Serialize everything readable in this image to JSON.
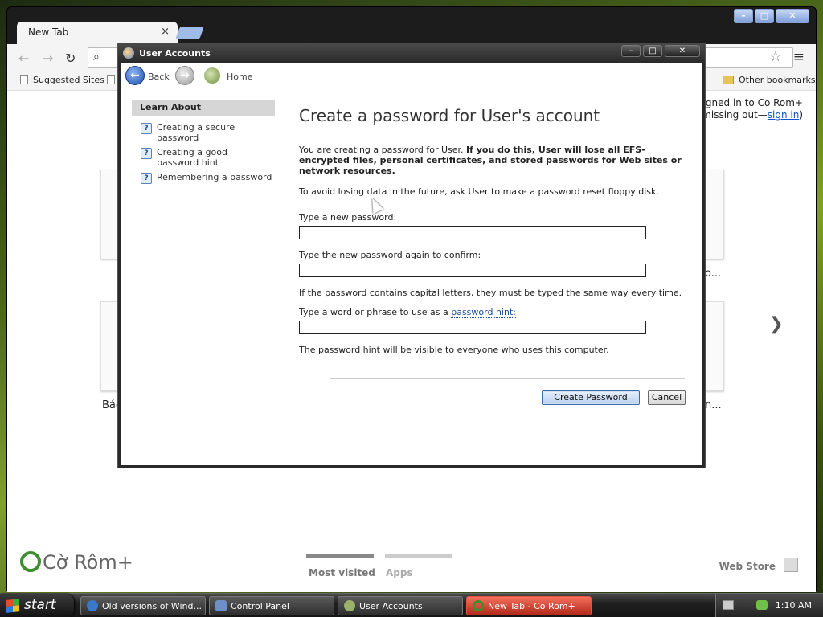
{
  "browser": {
    "tab_title": "New Tab",
    "tab_close": "×",
    "bookmarks": {
      "suggested": "Suggested Sites",
      "other": "Other bookmarks"
    },
    "ntp": {
      "signin_line1": "signed in to Co Rom+",
      "signin_line2_prefix": "e missing out—",
      "signin_link": "sign in",
      "signin_suffix": ")",
      "caption_left": "Bác",
      "caption_right_top": "o...",
      "caption_right_bottom": "n...",
      "next_arrow": "❯",
      "brand": "Cờ Rôm+",
      "tab_most_visited": "Most visited",
      "tab_apps": "Apps",
      "webstore": "Web Store"
    }
  },
  "dialog": {
    "title": "User Accounts",
    "nav": {
      "back": "Back",
      "home": "Home"
    },
    "sidebar": {
      "header": "Learn About",
      "items": [
        {
          "label": "Creating a secure password"
        },
        {
          "label": "Creating a good password hint"
        },
        {
          "label": "Remembering a password"
        }
      ]
    },
    "heading": "Create a password for User's account",
    "warning_plain": "You are creating a password for User. ",
    "warning_bold": "If you do this, User will lose all EFS-encrypted files, personal certificates, and stored passwords for Web sites or network resources.",
    "advice": "To avoid losing data in the future, ask User to make a password reset floppy disk.",
    "fields": {
      "new_password_label": "Type a new password:",
      "new_password_value": "",
      "confirm_label": "Type the new password again to confirm:",
      "confirm_value": "",
      "caps_note": "If the password contains capital letters, they must be typed the same way every time.",
      "hint_label_prefix": "Type a word or phrase to use as a ",
      "hint_label_link": "password hint:",
      "hint_value": "",
      "hint_note": "The password hint will be visible to everyone who uses this computer."
    },
    "buttons": {
      "create": "Create Password",
      "cancel": "Cancel"
    }
  },
  "taskbar": {
    "start": "start",
    "items": [
      {
        "label": "Old versions of Wind..."
      },
      {
        "label": "Control Panel"
      },
      {
        "label": "User Accounts"
      },
      {
        "label": "New Tab - Co Rom+"
      }
    ],
    "clock": "1:10 AM"
  },
  "colors": {
    "dialog_frame": "#2a2a2a",
    "link": "#1c4b9c",
    "active_task": "#d9402c",
    "brand_green": "#3e8e2f"
  }
}
